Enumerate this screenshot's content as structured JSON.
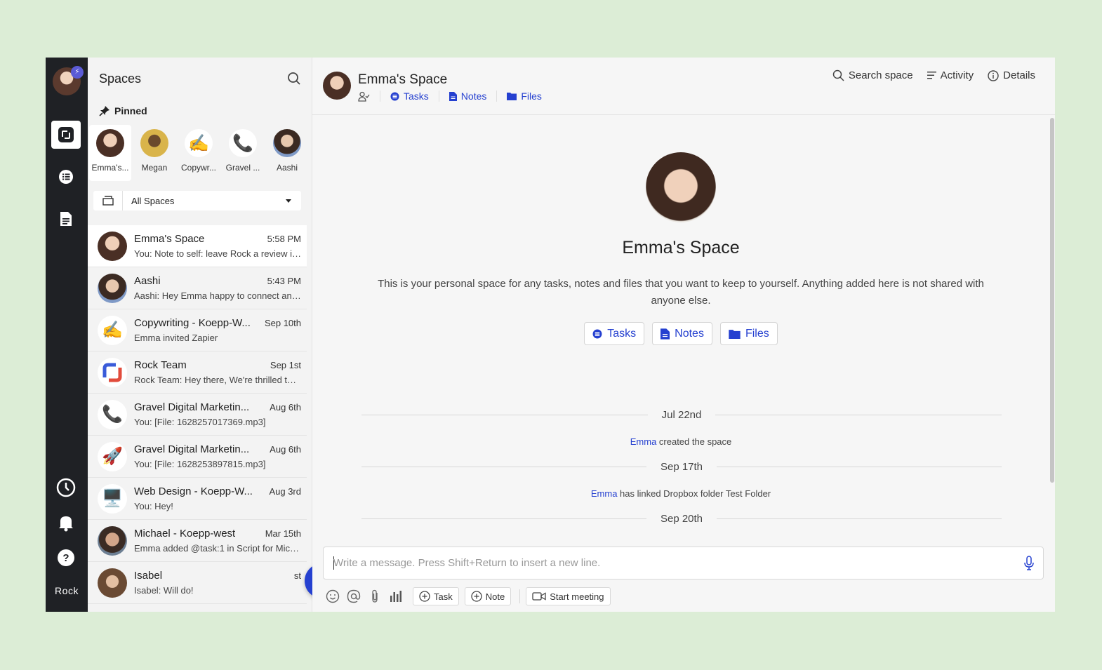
{
  "rail": {
    "brand": "Rock",
    "bolt_glyph": "⚡"
  },
  "sidebar": {
    "title": "Spaces",
    "pinned_label": "Pinned",
    "pins": [
      {
        "label": "Emma's...",
        "emoji": ""
      },
      {
        "label": "Megan",
        "emoji": ""
      },
      {
        "label": "Copywr...",
        "emoji": "✍️"
      },
      {
        "label": "Gravel ...",
        "emoji": "📞"
      },
      {
        "label": "Aashi",
        "emoji": ""
      }
    ],
    "filter_label": "All Spaces",
    "spaces": [
      {
        "name": "Emma's Space",
        "time": "5:58 PM",
        "preview": "You: Note to self: leave Rock a review in ...",
        "emoji": ""
      },
      {
        "name": "Aashi",
        "time": "5:43 PM",
        "preview": "Aashi: Hey Emma happy to connect and ...",
        "emoji": ""
      },
      {
        "name": "Copywriting - Koepp-W...",
        "time": "Sep 10th",
        "preview": "Emma invited Zapier",
        "emoji": "✍️"
      },
      {
        "name": "Rock Team",
        "time": "Sep 1st",
        "preview": "Rock Team: Hey there, We're thrilled to a...",
        "emoji": ""
      },
      {
        "name": "Gravel Digital Marketin...",
        "time": "Aug 6th",
        "preview": "You: [File: 1628257017369.mp3]",
        "emoji": "📞"
      },
      {
        "name": "Gravel Digital Marketin...",
        "time": "Aug 6th",
        "preview": "You: [File: 1628253897815.mp3]",
        "emoji": "🚀"
      },
      {
        "name": "Web Design - Koepp-W...",
        "time": "Aug 3rd",
        "preview": "You: Hey!",
        "emoji": "🖥️"
      },
      {
        "name": "Michael - Koepp-west",
        "time": "Mar 15th",
        "preview": "Emma added @task:1 in Script for Mich...",
        "emoji": ""
      },
      {
        "name": "Isabel",
        "time": "st",
        "preview": "Isabel: Will do!",
        "emoji": ""
      }
    ],
    "fab_label": "+"
  },
  "header": {
    "title": "Emma's Space",
    "links": [
      "Tasks",
      "Notes",
      "Files"
    ],
    "search_label": "Search space",
    "activity_label": "Activity",
    "details_label": "Details"
  },
  "hero": {
    "title": "Emma's Space",
    "description": "This is your personal space for any tasks, notes and files that you want to keep to yourself. Anything added here is not shared with anyone else.",
    "buttons": [
      "Tasks",
      "Notes",
      "Files"
    ]
  },
  "timeline": [
    {
      "date": "Jul 22nd",
      "actor": "Emma",
      "text": " created the space"
    },
    {
      "date": "Sep 17th",
      "actor": "Emma",
      "text": " has linked Dropbox folder Test Folder"
    },
    {
      "date": "Sep 20th"
    }
  ],
  "composer": {
    "placeholder": "Write a message. Press Shift+Return to insert a new line.",
    "task_label": "Task",
    "note_label": "Note",
    "meeting_label": "Start meeting"
  },
  "colors": {
    "accent": "#2540d0",
    "rail": "#1f2125",
    "background": "#dcedd6"
  }
}
